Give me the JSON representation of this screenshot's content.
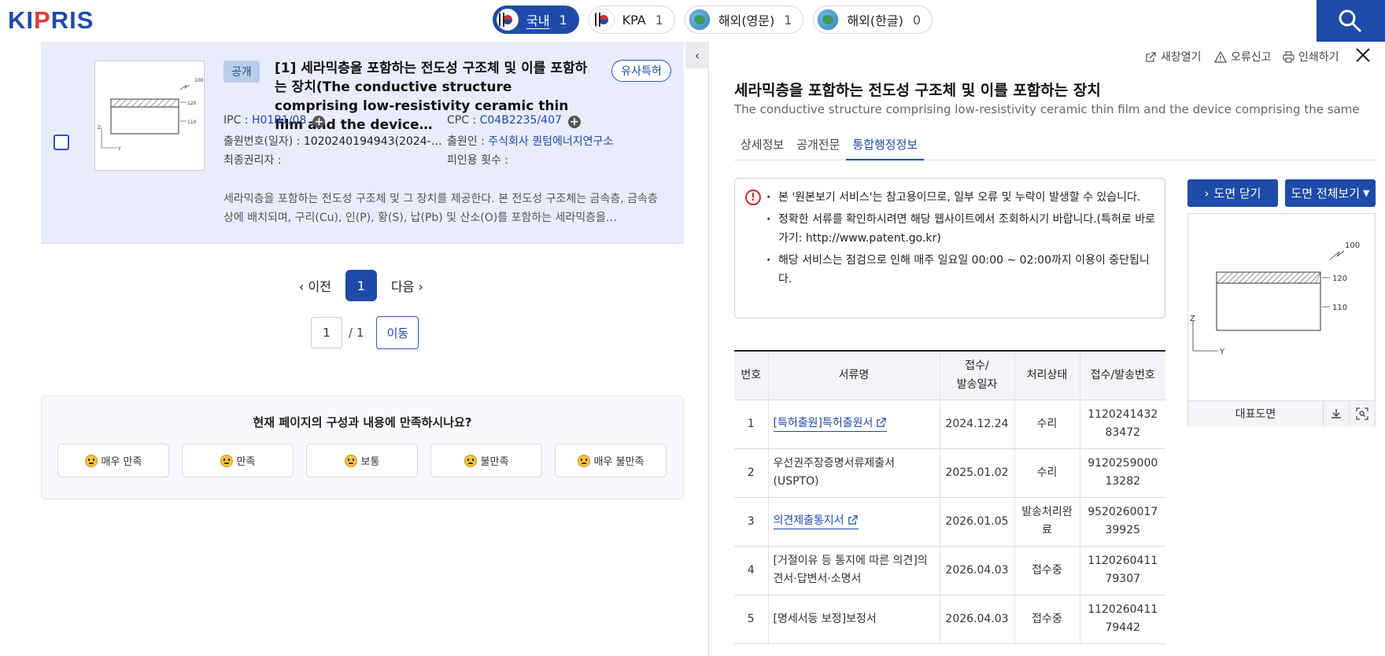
{
  "header": {
    "logo_text_a": "KI",
    "logo_text_b": "P",
    "logo_text_c": "RIS",
    "tabs": [
      {
        "label": "국내",
        "count": "1",
        "active": true,
        "flag": "kr-flag-icon"
      },
      {
        "label": "KPA",
        "count": "1",
        "active": false,
        "flag": "kr-flag-icon"
      },
      {
        "label": "해외(영문)",
        "count": "1",
        "active": false,
        "flag": "globe-icon"
      },
      {
        "label": "해외(한글)",
        "count": "0",
        "active": false,
        "flag": "globe-icon"
      }
    ],
    "search_icon": "search-icon"
  },
  "result": {
    "status_badge": "공개",
    "title": "[1] 세라믹층을 포함하는 전도성 구조체 및 이를 포함하는 장치(The conductive structure comprising low-resistivity ceramic thin film and the device…",
    "similar_button": "유사특허",
    "ipc_label": "IPC : ",
    "ipc_value": "H01B1/08",
    "cpc_label": "CPC : ",
    "cpc_value": "C04B2235/407",
    "appno_label": "출원번호(일자) : ",
    "appno_value": "1020240194943(2024-…",
    "applicant_label": "출원인 : ",
    "applicant_value": "주식회사 퀀텀에너지연구소",
    "owner_label": "최종권리자 : ",
    "cited_label": "피인용 횟수 : ",
    "abstract": "세라믹층을 포함하는 전도성 구조체 및 그 장치를 제공한다. 본 전도성 구조체는 금속층, 금속층상에 배치되며, 구리(Cu), 인(P), 황(S), 납(Pb) 및 산소(O)를 포함하는 세라믹층을…"
  },
  "pager": {
    "prev": "이전",
    "current": "1",
    "next": "다음",
    "input_value": "1",
    "total": "/ 1",
    "go": "이동"
  },
  "survey": {
    "question": "현재 페이지의 구성과 내용에 만족하시나요?",
    "options": [
      "매우 만족",
      "만족",
      "보통",
      "불만족",
      "매우 불만족"
    ]
  },
  "detail": {
    "tools": {
      "new_window": "새창열기",
      "report_error": "오류신고",
      "print": "인쇄하기"
    },
    "title": "세라믹층을 포함하는 전도성 구조체 및 이를 포함하는 장치",
    "subtitle": "The conductive structure comprising low-resistivity ceramic thin film and the device comprising the same",
    "tabs": [
      "상세정보",
      "공개전문",
      "통합행정정보"
    ],
    "active_tab": "통합행정정보",
    "notice": [
      "본 '원본보기 서비스'는 참고용이므로, 일부 오류 및 누락이 발생할 수 있습니다.",
      "정확한 서류를 확인하시려면 해당 웹사이트에서 조회하시기 바랍니다.(특허로 바로가기: http://www.patent.go.kr)",
      "해당 서비스는 점검으로 인해 매주 일요일 00:00 ~ 02:00까지 이용이 중단됩니다."
    ],
    "table": {
      "headers": [
        "번호",
        "서류명",
        "접수/\n발송일자",
        "처리상태",
        "접수/발송번호"
      ],
      "rows": [
        {
          "no": "1",
          "name": "[특허출원]특허출원서",
          "link": true,
          "date": "2024.12.24",
          "status": "수리",
          "docno": "112024143283472"
        },
        {
          "no": "2",
          "name": "우선권주장증명서류제출서(USPTO)",
          "link": false,
          "date": "2025.01.02",
          "status": "수리",
          "docno": "912025900013282"
        },
        {
          "no": "3",
          "name": "의견제출통지서",
          "link": true,
          "date": "2026.01.05",
          "status": "발송처리완료",
          "docno": "952026001739925"
        },
        {
          "no": "4",
          "name": "[거절이유 등 통지에 따른 의견]의견서·답변서·소명서",
          "link": false,
          "date": "2026.04.03",
          "status": "접수중",
          "docno": "112026041179307"
        },
        {
          "no": "5",
          "name": "[명세서등 보정]보정서",
          "link": false,
          "date": "2026.04.03",
          "status": "접수중",
          "docno": "112026041179442"
        }
      ]
    },
    "drawing": {
      "close_button": "도면 닫기",
      "full_button": "도면 전체보기",
      "caption": "대표도면",
      "labels": [
        "100",
        "120",
        "110",
        "Z",
        "Y"
      ]
    }
  },
  "colors": {
    "brand_blue": "#1f4aa8",
    "card_bg": "#e9ecfb",
    "logo_red": "#e23a3a"
  }
}
